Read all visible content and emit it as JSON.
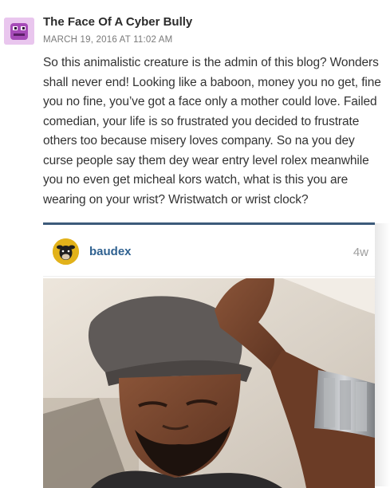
{
  "comment": {
    "author": "The Face Of A Cyber Bully",
    "timestamp": "MARCH 19, 2016 AT 11:02 AM",
    "body": "So this animalistic creature is the admin of this blog? Wonders shall never end! Looking like a baboon, money you no get, fine you no fine, you’ve got a face only a mother could love. Failed comedian, your life is so frustrated you decided to frustrate others too because misery loves company. So na you dey curse people say them dey wear entry level rolex meanwhile you no even get micheal kors watch, what is this you are wearing on your wrist? Wristwatch or wrist clock?"
  },
  "embed": {
    "username": "baudex",
    "age": "4w"
  },
  "colors": {
    "accent_border": "#3c5a7a",
    "username": "#2f6190",
    "avatar_bg": "#e9c6ee"
  }
}
